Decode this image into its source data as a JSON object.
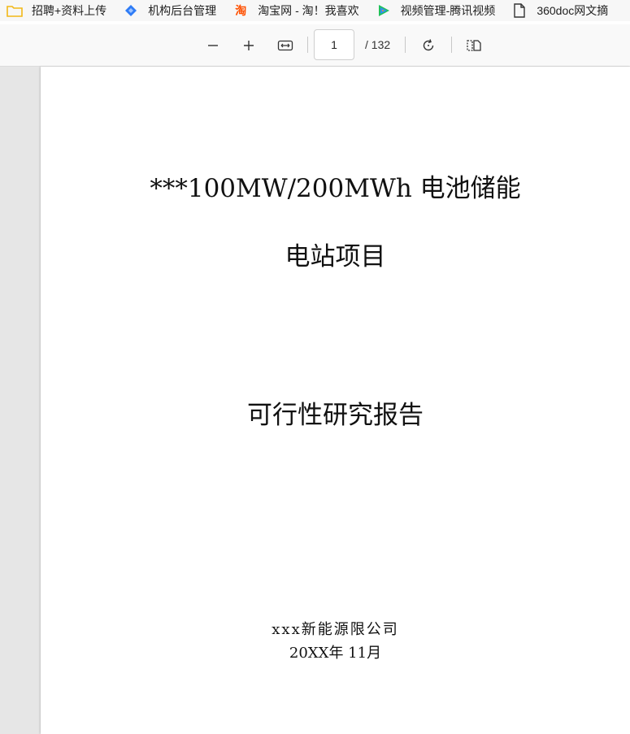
{
  "bookmarks": [
    {
      "label": "招聘+资料上传",
      "icon": "folder-icon"
    },
    {
      "label": "机构后台管理",
      "icon": "diamond-logo-icon"
    },
    {
      "label": "淘宝网 - 淘！我喜欢",
      "icon": "taobao-icon"
    },
    {
      "label": "视频管理-腾讯视频",
      "icon": "tencent-video-icon"
    },
    {
      "label": "360doc网文摘",
      "icon": "document-icon"
    }
  ],
  "toolbar": {
    "current_page": "1",
    "total_pages": "/ 132"
  },
  "document": {
    "title_line1": "***100MW/200MWh 电池储能",
    "title_line2": "电站项目",
    "subtitle": "可行性研究报告",
    "company": "xxx新能源限公司",
    "date": "20XX年 11月"
  },
  "colors": {
    "folder": "#f2b817",
    "diamond_logo": "#2f7cf6",
    "taobao": "#ff5000",
    "tencent_video_green": "#20c05c",
    "tencent_video_blue": "#2f8df5",
    "tencent_video_orange": "#ff9a1a"
  }
}
